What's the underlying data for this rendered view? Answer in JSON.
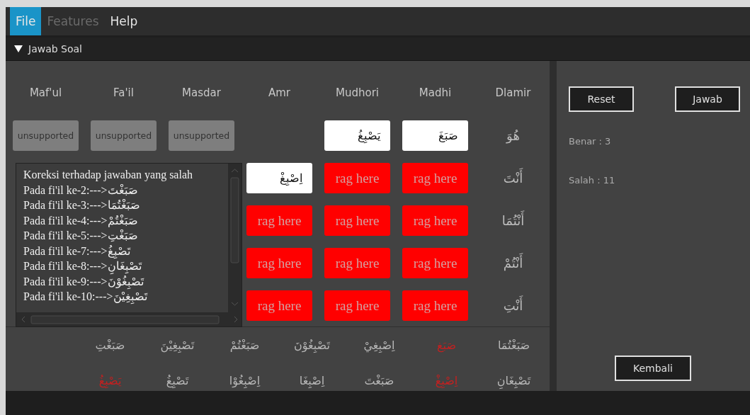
{
  "menu": {
    "file": {
      "label": "File",
      "selected": true,
      "disabled": false
    },
    "features": {
      "label": "Features",
      "selected": false,
      "disabled": true
    },
    "help": {
      "label": "Help",
      "selected": false,
      "disabled": false
    }
  },
  "section": {
    "title": "Jawab Soal",
    "expanded": true
  },
  "grid": {
    "columns": [
      "Dlamir",
      "Madhi",
      "Mudhori",
      "Amr",
      "Masdar",
      "Fa'il",
      "Maf'ul"
    ],
    "rows": [
      {
        "cells": [
          {
            "kind": "pronoun",
            "text": "هُوَ"
          },
          {
            "kind": "answer",
            "text": "صَبَغَ"
          },
          {
            "kind": "answer",
            "text": "يَصْبِغُ"
          },
          {
            "kind": "empty"
          },
          {
            "kind": "unsupported",
            "text": "unsupported"
          },
          {
            "kind": "unsupported",
            "text": "unsupported"
          },
          {
            "kind": "unsupported",
            "text": "unsupported"
          }
        ]
      },
      {
        "cells": [
          {
            "kind": "pronoun",
            "text": "أَنْتَ"
          },
          {
            "kind": "drop",
            "text": "rag here"
          },
          {
            "kind": "drop",
            "text": "rag here"
          },
          {
            "kind": "answer",
            "text": "اِصْبِغْ"
          }
        ]
      },
      {
        "cells": [
          {
            "kind": "pronoun",
            "text": "أَنْتُمَا"
          },
          {
            "kind": "drop",
            "text": "rag here"
          },
          {
            "kind": "drop",
            "text": "rag here"
          },
          {
            "kind": "drop",
            "text": "rag here"
          }
        ]
      },
      {
        "cells": [
          {
            "kind": "pronoun",
            "text": "أَنْتُمْ"
          },
          {
            "kind": "drop",
            "text": "rag here"
          },
          {
            "kind": "drop",
            "text": "rag here"
          },
          {
            "kind": "drop",
            "text": "rag here"
          }
        ]
      },
      {
        "cells": [
          {
            "kind": "pronoun",
            "text": "أَنْتِ"
          },
          {
            "kind": "drop",
            "text": "rag here"
          },
          {
            "kind": "drop",
            "text": "rag here"
          },
          {
            "kind": "drop",
            "text": "rag here"
          }
        ]
      }
    ]
  },
  "corrections": {
    "lines": [
      "Koreksi terhadap jawaban yang salah",
      "Pada fi'il ke-2:--->صَبَغْتَ",
      "Pada fi'il ke-3:--->صَبَغْتُمَا",
      "Pada fi'il ke-4:--->صَبَغْتُمْ",
      "Pada fi'il ke-5:--->صَبَغْتِ",
      "Pada fi'il ke-7:--->تَصْبِغُ",
      "Pada fi'il ke-8:--->تَصْبِغَانِ",
      "Pada fi'il ke-9:--->تَصْبِغُوْنَ",
      "Pada fi'il ke-10:--->تَصْبِغِيْنَ"
    ]
  },
  "word_pool": {
    "rows": [
      [
        {
          "text": "صَبَغْتُمَا",
          "used": false
        },
        {
          "text": "صَبَغ",
          "used": true
        },
        {
          "text": "اِصْبِغِيْ",
          "used": false
        },
        {
          "text": "تَصْبِغُوْنَ",
          "used": false
        },
        {
          "text": "صَبَغْتُمْ",
          "used": false
        },
        {
          "text": "تَصْبِغِيْنَ",
          "used": false
        },
        {
          "text": "صَبَغْتِ",
          "used": false
        }
      ],
      [
        {
          "text": "تَصْبِغَانِ",
          "used": false
        },
        {
          "text": "اِصْبِغْ",
          "used": true
        },
        {
          "text": "صَبَغْتَ",
          "used": false
        },
        {
          "text": "اِصْبِغَا",
          "used": false
        },
        {
          "text": "اِصْبِغُوْا",
          "used": false
        },
        {
          "text": "تَصْبِغُ",
          "used": false
        },
        {
          "text": "يَصْبِغُ",
          "used": true
        }
      ]
    ]
  },
  "side": {
    "reset_button": "Reset",
    "answer_button": "Jawab",
    "benar": "Benar : 3",
    "salah": "Salah : 11",
    "back_button": "Kembali"
  }
}
